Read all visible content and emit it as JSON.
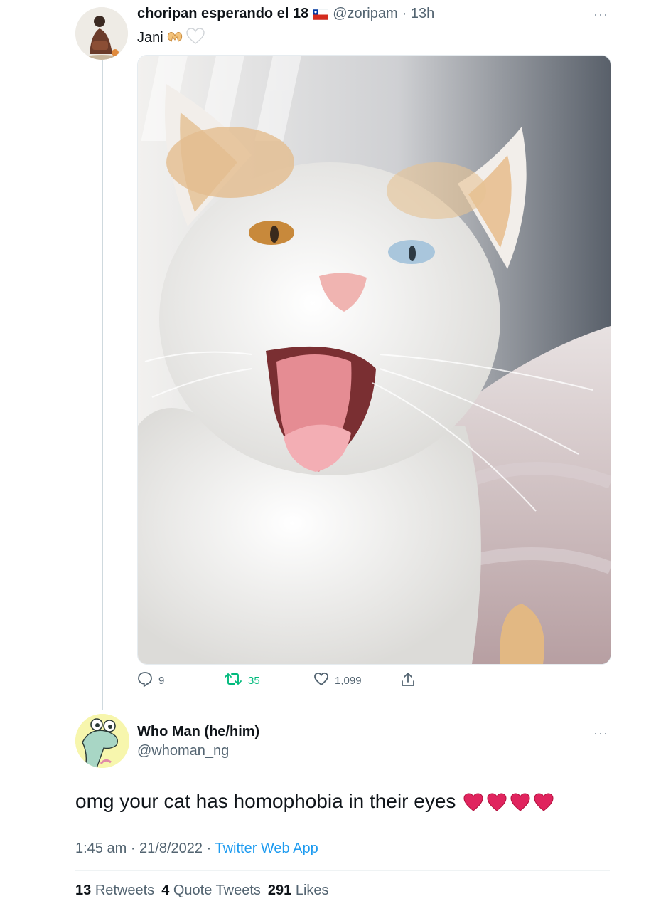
{
  "tweet": {
    "display_name": "choripan esperando el 18",
    "handle": "@zoripam",
    "time": "· 13h",
    "text": "Jani",
    "flag_icon": "chile-flag-icon",
    "emoji": [
      "heart-hands-icon",
      "white-heart-icon"
    ],
    "actions": {
      "replies": "9",
      "retweets": "35",
      "likes": "1,099"
    },
    "retweet_color": "#00ba7c"
  },
  "reply": {
    "display_name": "Who Man (he/him)",
    "handle": "@whoman_ng",
    "text": "omg your cat has homophobia in their eyes",
    "heart_count": 4,
    "heart_color": "#e0245e",
    "time": "1:45 am",
    "date": "21/8/2022",
    "app": "Twitter Web App",
    "stats": {
      "retweets_count": "13",
      "retweets_label": "Retweets",
      "quotes_count": "4",
      "quotes_label": "Quote Tweets",
      "likes_count": "291",
      "likes_label": "Likes"
    }
  },
  "more_label": "···"
}
